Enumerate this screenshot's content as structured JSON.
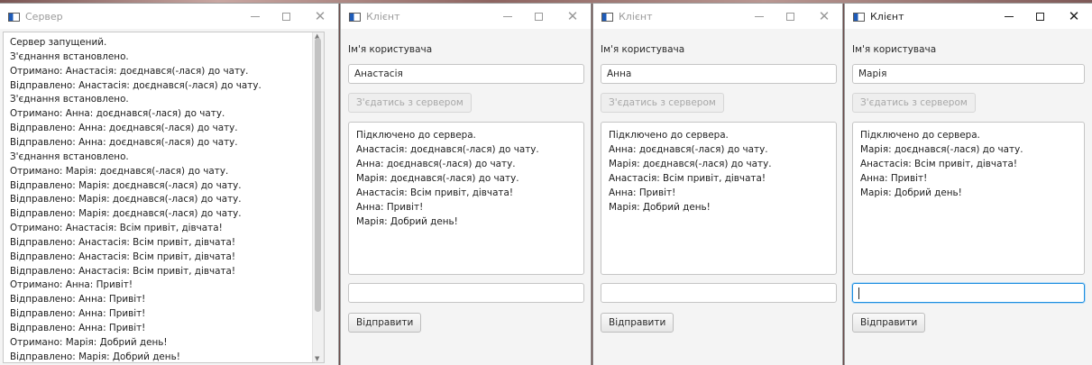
{
  "server": {
    "title": "Сервер",
    "log": [
      "Сервер запущений.",
      "З'єднання встановлено.",
      "Отримано: Анастасія: доєднався(-лася) до чату.",
      "Відправлено: Анастасія: доєднався(-лася) до чату.",
      "З'єднання встановлено.",
      "Отримано: Анна: доєднався(-лася) до чату.",
      "Відправлено: Анна: доєднався(-лася) до чату.",
      "Відправлено: Анна: доєднався(-лася) до чату.",
      "З'єднання встановлено.",
      "Отримано: Марія: доєднався(-лася) до чату.",
      "Відправлено: Марія: доєднався(-лася) до чату.",
      "Відправлено: Марія: доєднався(-лася) до чату.",
      "Відправлено: Марія: доєднався(-лася) до чату.",
      "Отримано: Анастасія: Всім привіт, дівчата!",
      "Відправлено: Анастасія: Всім привіт, дівчата!",
      "Відправлено: Анастасія: Всім привіт, дівчата!",
      "Відправлено: Анастасія: Всім привіт, дівчата!",
      "Отримано: Анна: Привіт!",
      "Відправлено: Анна: Привіт!",
      "Відправлено: Анна: Привіт!",
      "Відправлено: Анна: Привіт!",
      "Отримано: Марія: Добрий день!",
      "Відправлено: Марія: Добрий день!"
    ]
  },
  "clients": [
    {
      "title": "Клієнт",
      "username_label": "Ім'я користувача",
      "username": "Анастасія",
      "connect_label": "З'єдатись з сервером",
      "chat": [
        "Підключено до сервера.",
        "Анастасія: доєднався(-лася) до чату.",
        "Анна: доєднався(-лася) до чату.",
        "Марія: доєднався(-лася) до чату.",
        "Анастасія: Всім привіт, дівчата!",
        "Анна: Привіт!",
        "Марія: Добрий день!"
      ],
      "message": "",
      "send_label": "Відправити"
    },
    {
      "title": "Клієнт",
      "username_label": "Ім'я користувача",
      "username": "Анна",
      "connect_label": "З'єдатись з сервером",
      "chat": [
        "Підключено до сервера.",
        "Анна: доєднався(-лася) до чату.",
        "Марія: доєднався(-лася) до чату.",
        "Анастасія: Всім привіт, дівчата!",
        "Анна: Привіт!",
        "Марія: Добрий день!"
      ],
      "message": "",
      "send_label": "Відправити"
    },
    {
      "title": "Клієнт",
      "username_label": "Ім'я користувача",
      "username": "Марія",
      "connect_label": "З'єдатись з сервером",
      "chat": [
        "Підключено до сервера.",
        "Марія: доєднався(-лася) до чату.",
        "Анастасія: Всім привіт, дівчата!",
        "Анна: Привіт!",
        "Марія: Добрий день!"
      ],
      "message": "",
      "send_label": "Відправити"
    }
  ]
}
